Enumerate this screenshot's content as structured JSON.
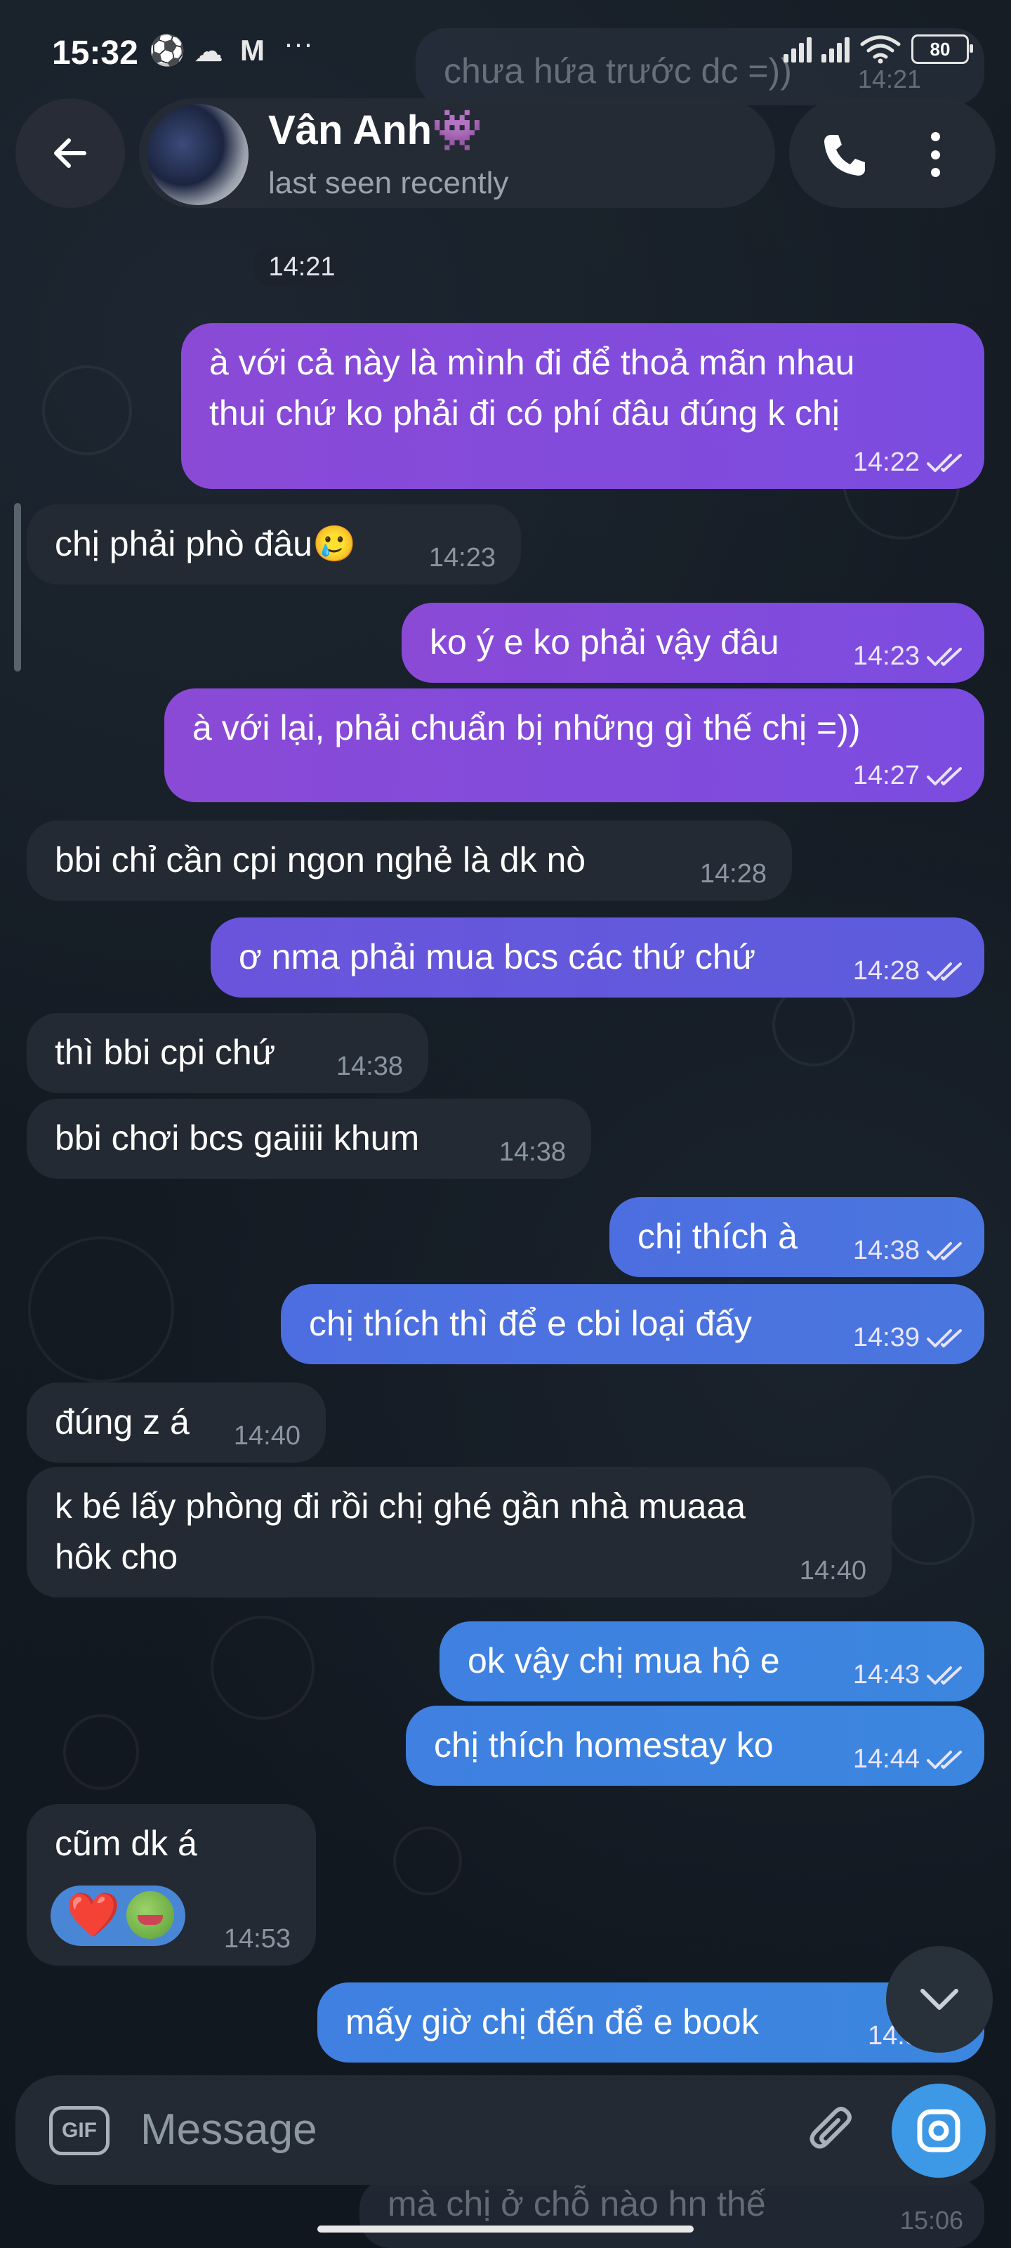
{
  "status_bar": {
    "time": "15:32",
    "battery": "80",
    "icons": [
      "soccer-ball-icon",
      "cloud-icon",
      "gmail-icon",
      "more-icon",
      "signal-icon",
      "signal-icon",
      "wifi-icon",
      "battery-icon"
    ]
  },
  "header": {
    "name": "Vân Anh👾",
    "status": "last seen recently",
    "icons": [
      "back-arrow-icon",
      "phone-icon",
      "more-vertical-icon"
    ]
  },
  "ghost_messages": [
    {
      "text": "chưa hứa trước dc =))",
      "time": "14:21"
    },
    {
      "text": "mà chị ở chỗ nào hn thế",
      "time": "15:06"
    }
  ],
  "day_chip": "14:21",
  "messages": [
    {
      "side": "out",
      "lines": [
        "à với cả này là mình đi để thoả mãn nhau",
        "thui chứ ko phải đi có phí đâu đúng k chị"
      ],
      "time": "14:22"
    },
    {
      "side": "in",
      "lines": [
        "chị phải phò đâu🥲"
      ],
      "time": "14:23"
    },
    {
      "side": "out",
      "lines": [
        "ko ý e ko phải vậy đâu"
      ],
      "time": "14:23"
    },
    {
      "side": "out",
      "lines": [
        "à với lại, phải chuẩn bị những gì thế chị =))"
      ],
      "time": "14:27"
    },
    {
      "side": "in",
      "lines": [
        "bbi chỉ cần cpi ngon nghẻ là dk nò"
      ],
      "time": "14:28"
    },
    {
      "side": "out",
      "lines": [
        "ơ nma phải mua bcs các thứ chứ"
      ],
      "time": "14:28"
    },
    {
      "side": "in",
      "lines": [
        "thì bbi cpi chứ"
      ],
      "time": "14:38"
    },
    {
      "side": "in",
      "lines": [
        "bbi chơi bcs gaiiii khum"
      ],
      "time": "14:38"
    },
    {
      "side": "out",
      "lines": [
        "chị thích à"
      ],
      "time": "14:38"
    },
    {
      "side": "out",
      "lines": [
        "chị thích thì để e cbi loại đấy"
      ],
      "time": "14:39"
    },
    {
      "side": "in",
      "lines": [
        "đúng z á"
      ],
      "time": "14:40"
    },
    {
      "side": "in",
      "lines": [
        "k bé lấy phòng đi rồi chị ghé gần nhà muaaa",
        "hôk cho"
      ],
      "time": "14:40"
    },
    {
      "side": "out",
      "lines": [
        "ok vậy chị mua hộ e"
      ],
      "time": "14:43"
    },
    {
      "side": "out",
      "lines": [
        "chị thích homestay ko"
      ],
      "time": "14:44"
    },
    {
      "side": "in",
      "lines": [
        "cũm dk á"
      ],
      "time": "14:53",
      "reactions": [
        "❤️",
        "pepe-frog-icon"
      ]
    },
    {
      "side": "out",
      "lines": [
        "mấy giờ chị đến để e book"
      ],
      "time": "14:5"
    }
  ],
  "composer": {
    "gif_label": "GIF",
    "placeholder": "Message",
    "icons": [
      "gif-icon",
      "attach-icon",
      "camera-icon"
    ]
  },
  "colors": {
    "background": "#141b23",
    "incoming_bubble": "#232a33",
    "outgoing_purple": "#8a4ad6",
    "outgoing_blue": "#3c86df",
    "camera_button": "#3d98e6"
  }
}
